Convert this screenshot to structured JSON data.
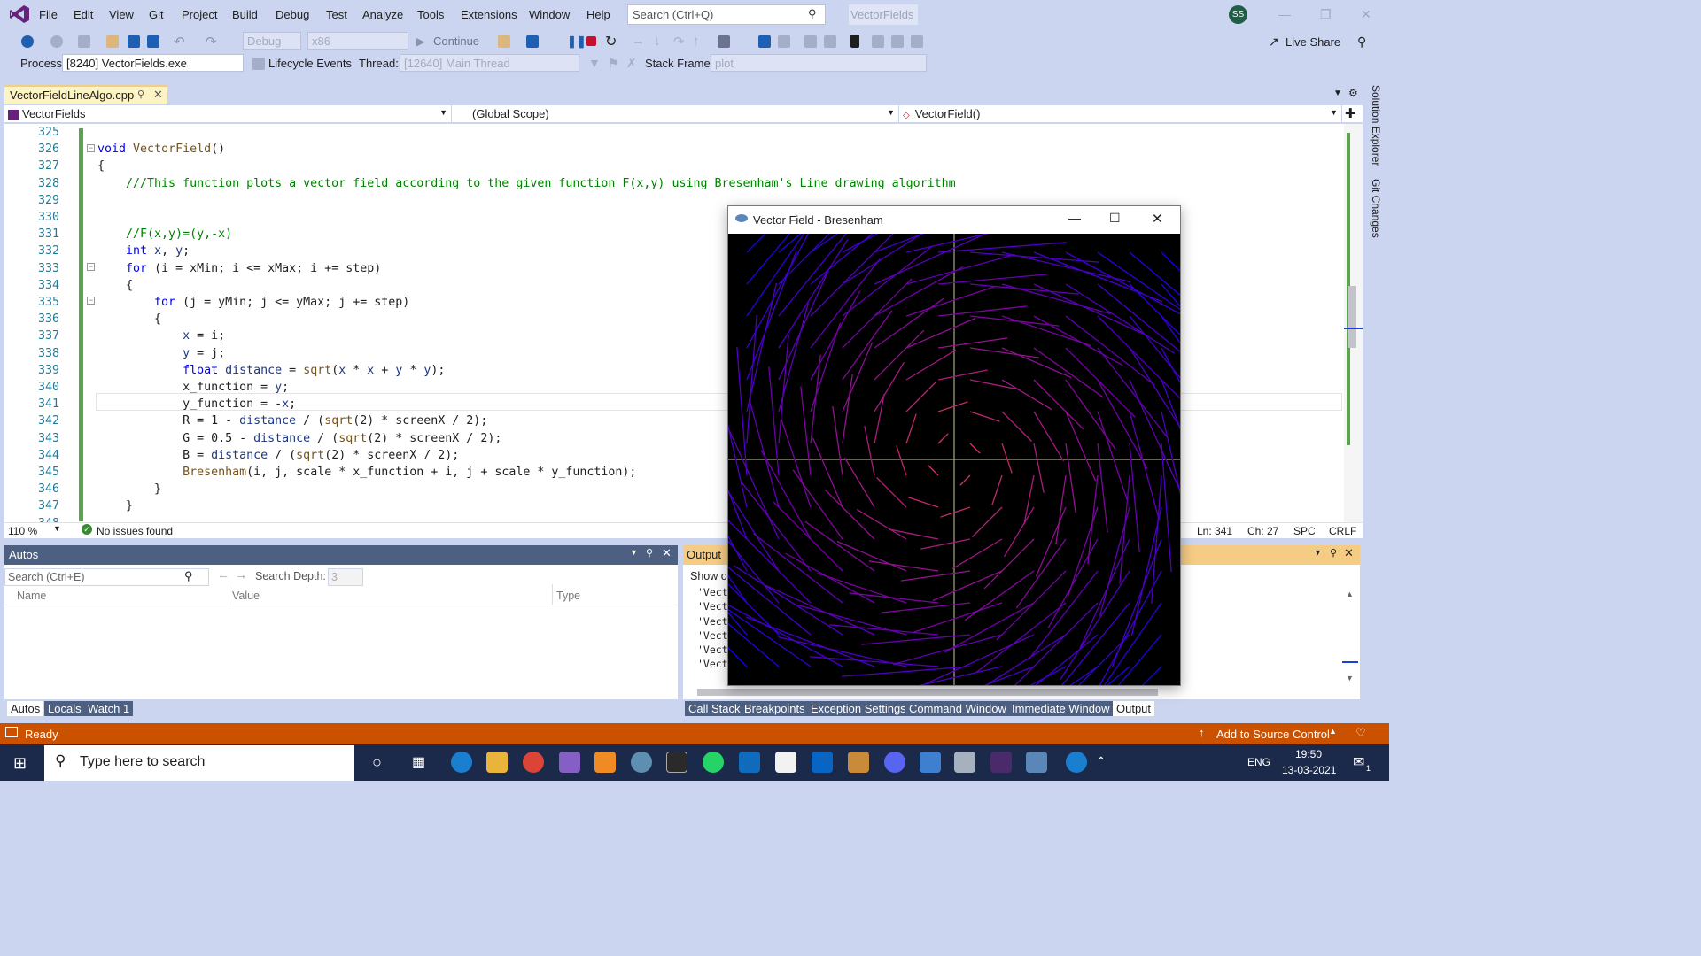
{
  "menu": [
    "File",
    "Edit",
    "View",
    "Git",
    "Project",
    "Build",
    "Debug",
    "Test",
    "Analyze",
    "Tools",
    "Extensions",
    "Window",
    "Help"
  ],
  "search": {
    "placeholder": "Search (Ctrl+Q)"
  },
  "solution_name": "VectorFields",
  "avatar": "SS",
  "live_share": "Live Share",
  "toolbar": {
    "config": "Debug",
    "platform": "x86",
    "continue": "Continue"
  },
  "debug_bar": {
    "process_label": "Process:",
    "process": "[8240] VectorFields.exe",
    "lifecycle": "Lifecycle Events",
    "thread_label": "Thread:",
    "thread": "[12640] Main Thread",
    "stack_label": "Stack Frame:",
    "stack": "plot"
  },
  "doc_tab": "VectorFieldLineAlgo.cpp",
  "nav": {
    "project": "VectorFields",
    "scope": "(Global Scope)",
    "member": "VectorField()"
  },
  "code": [
    {
      "n": "325",
      "t": ""
    },
    {
      "n": "326",
      "t": "void VectorField()"
    },
    {
      "n": "327",
      "t": "{"
    },
    {
      "n": "328",
      "t": "    ///This function plots a vector field according to the given function F(x,y) using Bresenham's Line drawing algorithm"
    },
    {
      "n": "329",
      "t": ""
    },
    {
      "n": "330",
      "t": ""
    },
    {
      "n": "331",
      "t": "    //F(x,y)=(y,-x)"
    },
    {
      "n": "332",
      "t": "    int x, y;"
    },
    {
      "n": "333",
      "t": "    for (i = xMin; i <= xMax; i += step)"
    },
    {
      "n": "334",
      "t": "    {"
    },
    {
      "n": "335",
      "t": "        for (j = yMin; j <= yMax; j += step)"
    },
    {
      "n": "336",
      "t": "        {"
    },
    {
      "n": "337",
      "t": "            x = i;"
    },
    {
      "n": "338",
      "t": "            y = j;"
    },
    {
      "n": "339",
      "t": "            float distance = sqrt(x * x + y * y);"
    },
    {
      "n": "340",
      "t": "            x_function = y;"
    },
    {
      "n": "341",
      "t": "            y_function = -x;"
    },
    {
      "n": "342",
      "t": "            R = 1 - distance / (sqrt(2) * screenX / 2);"
    },
    {
      "n": "343",
      "t": "            G = 0.5 - distance / (sqrt(2) * screenX / 2);"
    },
    {
      "n": "344",
      "t": "            B = distance / (sqrt(2) * screenX / 2);"
    },
    {
      "n": "345",
      "t": "            Bresenham(i, j, scale * x_function + i, j + scale * y_function);"
    },
    {
      "n": "346",
      "t": "        }"
    },
    {
      "n": "347",
      "t": "    }"
    },
    {
      "n": "348",
      "t": ""
    }
  ],
  "editor_status": {
    "zoom": "110 %",
    "issues": "No issues found",
    "ln": "Ln: 341",
    "ch": "Ch: 27",
    "spc": "SPC",
    "crlf": "CRLF"
  },
  "autos": {
    "title": "Autos",
    "search": "Search (Ctrl+E)",
    "depth_label": "Search Depth:",
    "depth": "3",
    "cols": [
      "Name",
      "Value",
      "Type"
    ]
  },
  "output": {
    "title": "Output",
    "show": "Show ou",
    "lines": [
      "'Vecto",
      "'Vecto",
      "'Vecto",
      "'Vecto",
      "'Vecto",
      "'Vecto"
    ]
  },
  "bottom_tabs_left": [
    "Autos",
    "Locals",
    "Watch 1"
  ],
  "bottom_tabs_right": [
    "Call Stack",
    "Breakpoints",
    "Exception Settings",
    "Command Window",
    "Immediate Window",
    "Output"
  ],
  "side_tabs": [
    "Solution Explorer",
    "Git Changes"
  ],
  "status": {
    "ready": "Ready",
    "source_control": "Add to Source Control"
  },
  "taskbar": {
    "search": "Type here to search",
    "lang": "ENG",
    "time": "19:50",
    "date": "13-03-2021",
    "notif": "1"
  },
  "popup": {
    "title": "Vector Field - Bresenham"
  },
  "colors": {
    "accent": "#ca5100",
    "navy": "#4d6082",
    "tab_gold": "#f5cc84",
    "field_blue": "#1010ff"
  }
}
